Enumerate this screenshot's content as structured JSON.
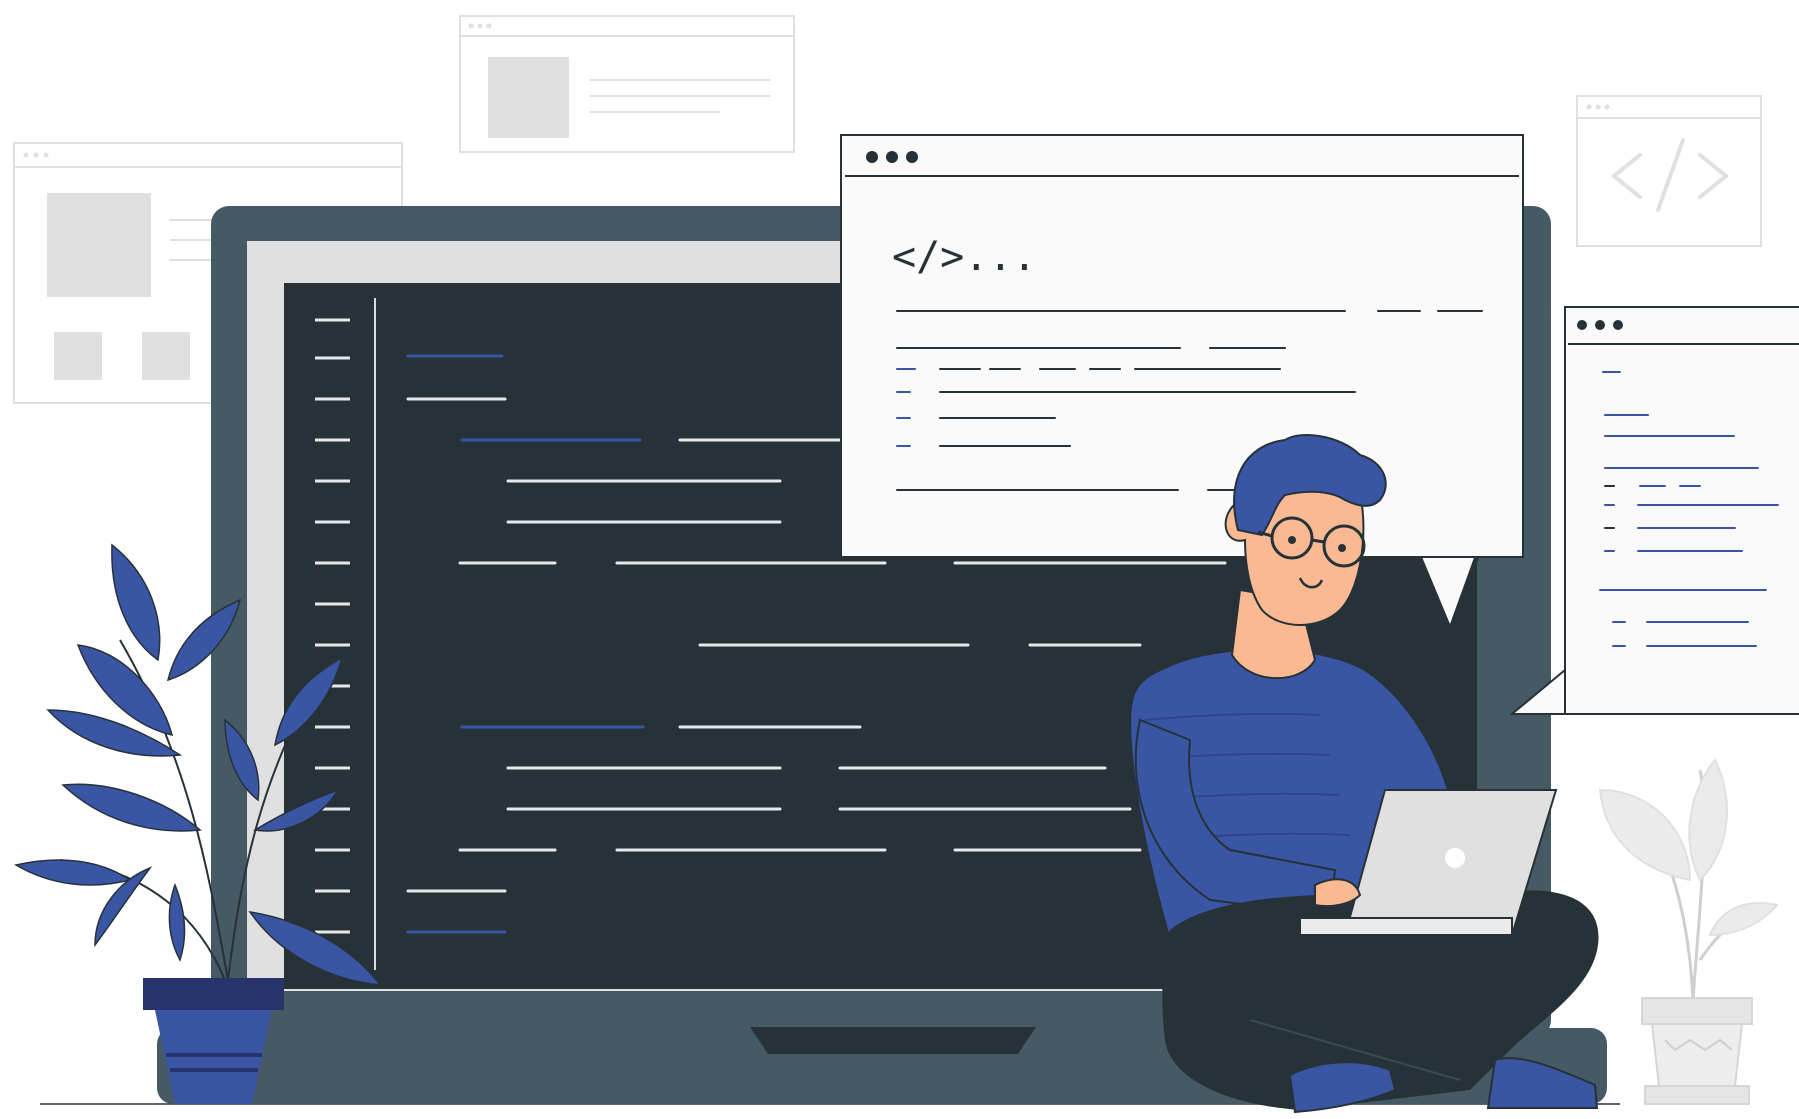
{
  "illustration": {
    "code_snippet": "</>...",
    "code_icon_name": "code-brackets-icon",
    "colors": {
      "background": "#ffffff",
      "screen_dark": "#263238",
      "monitor_frame": "#455a64",
      "panel_light": "#fafafa",
      "panel_border": "#263238",
      "ghost_gray": "#e0e0e0",
      "accent_blue": "#3a55a4",
      "skin": "#f9b992",
      "hair": "#3a55a4",
      "laptop": "#e0e0e0",
      "pot_blue": "#27336b",
      "pants": "#263238"
    }
  }
}
